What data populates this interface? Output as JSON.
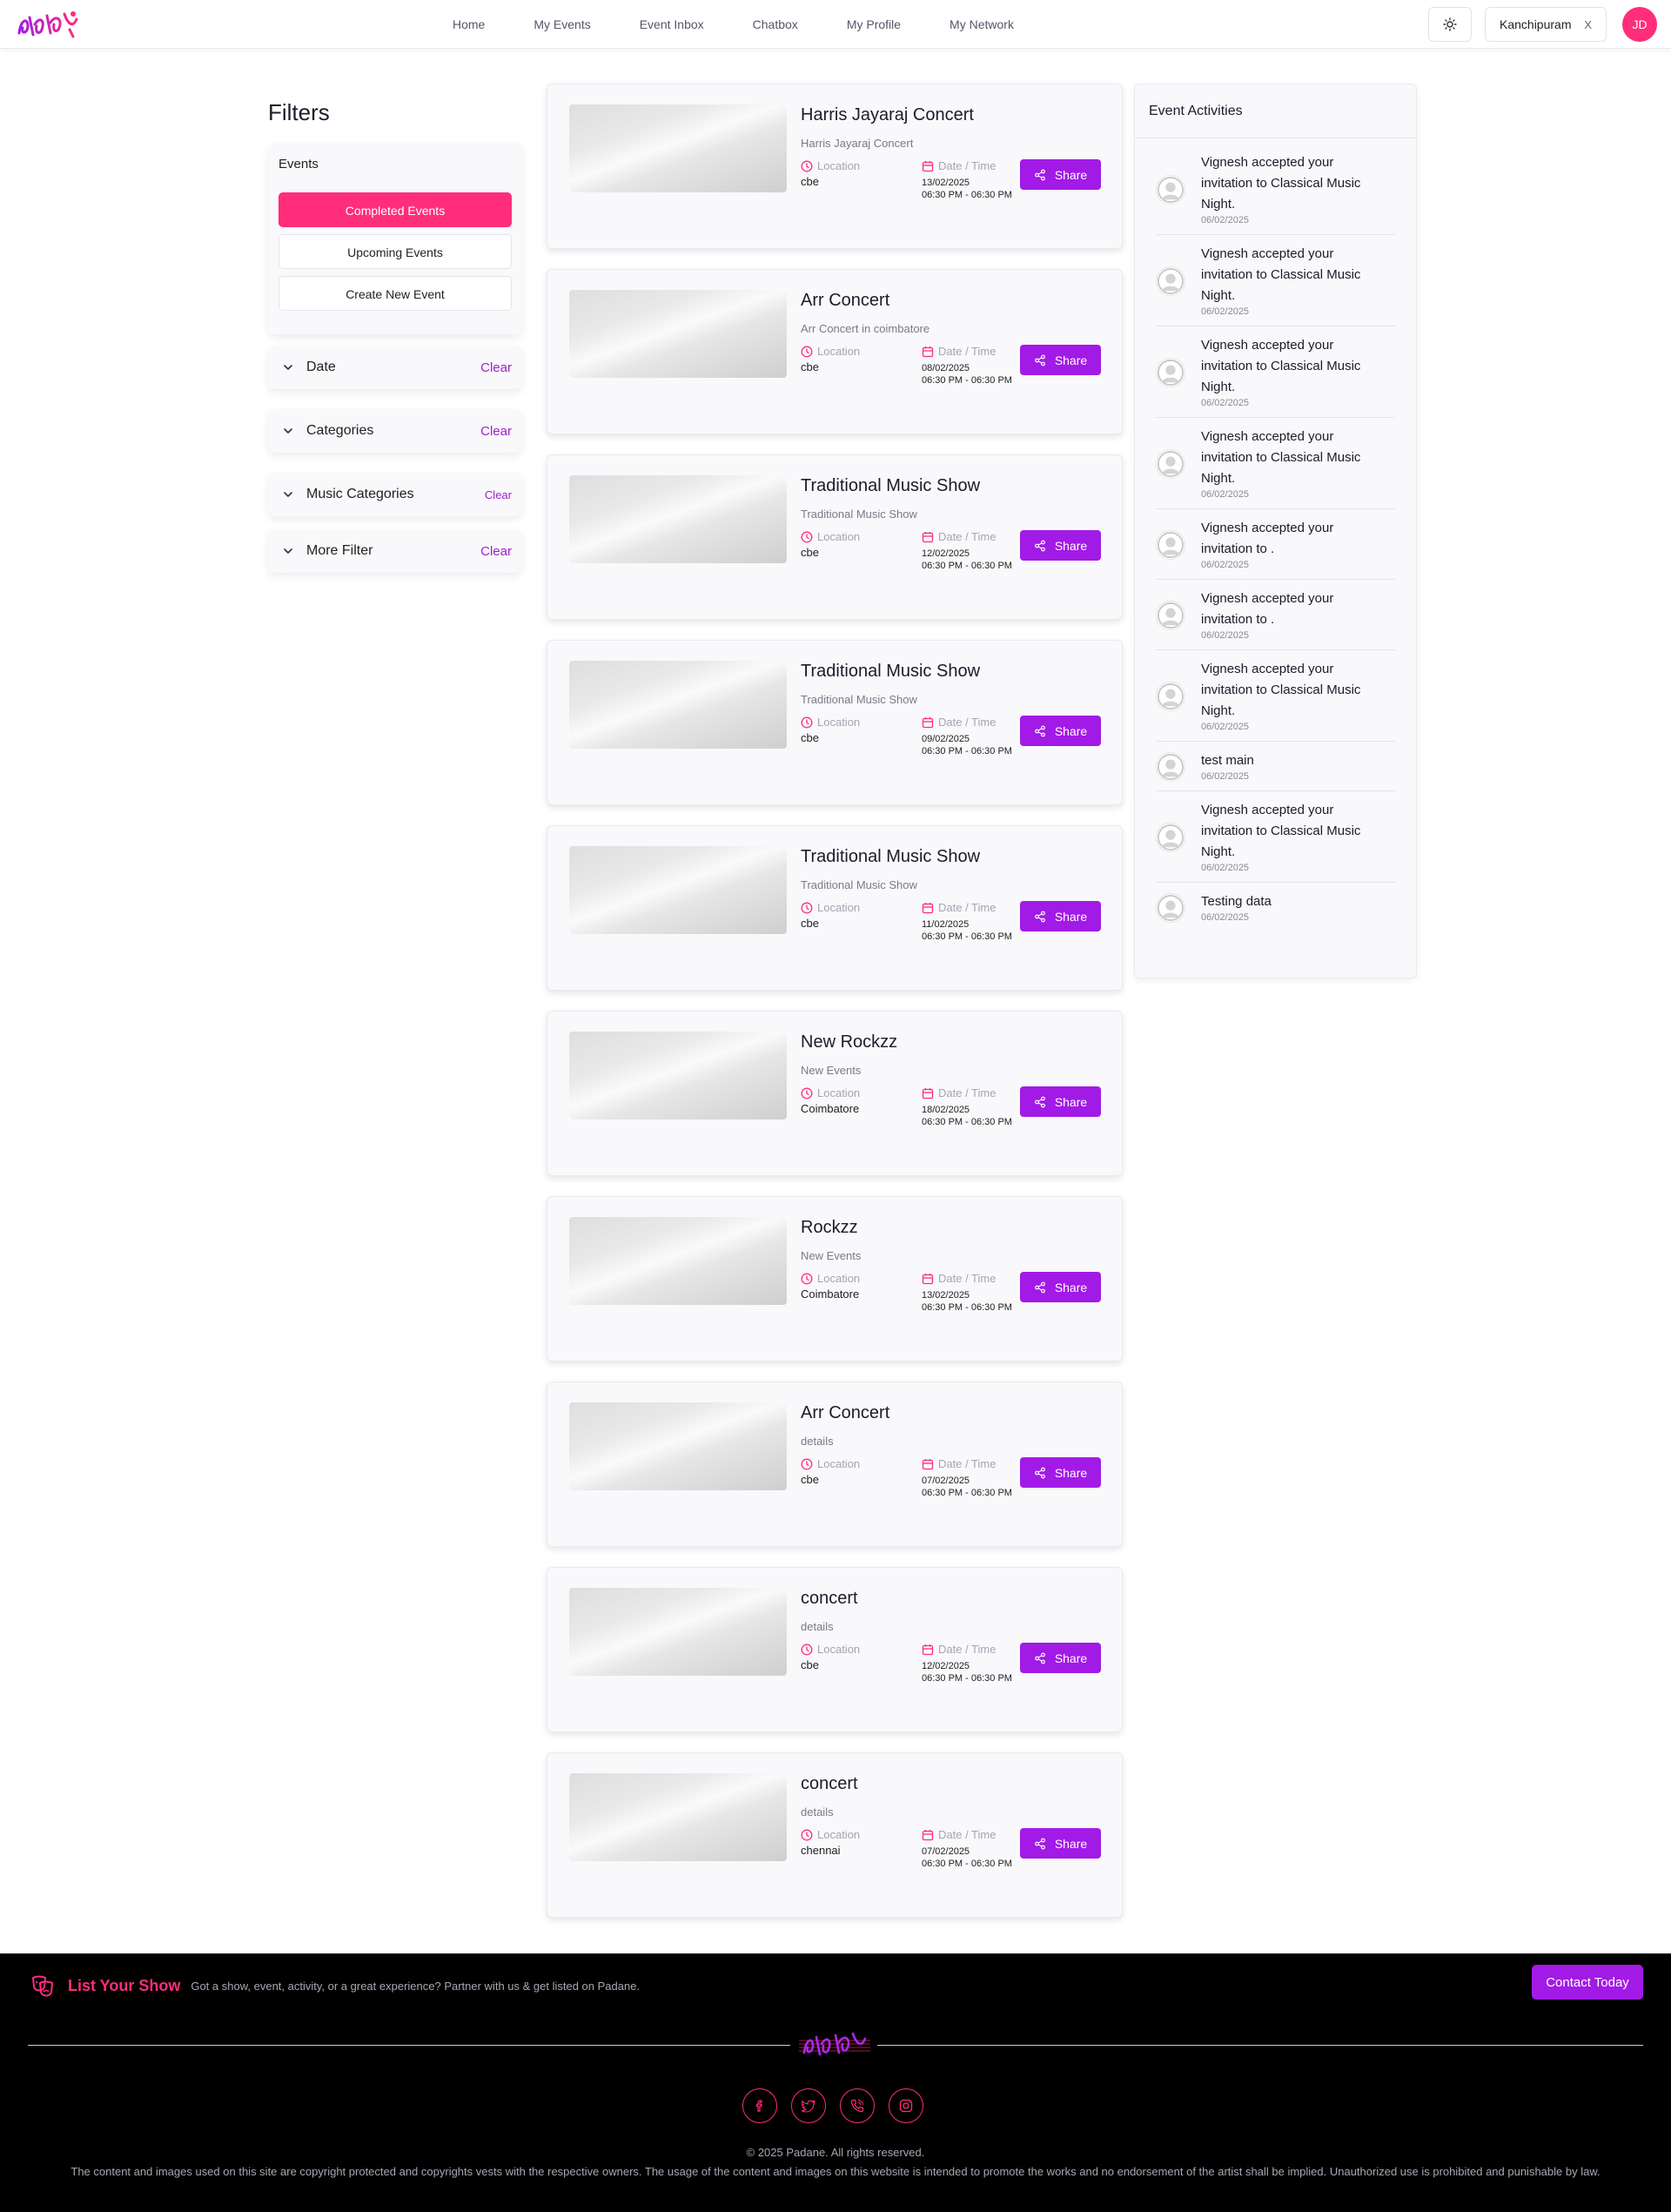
{
  "header": {
    "logo_alt": "Padane",
    "nav": [
      "Home",
      "My Events",
      "Event Inbox",
      "Chatbox",
      "My Profile",
      "My Network"
    ],
    "location": "Kanchipuram",
    "location_clear": "X",
    "avatar_initials": "JD"
  },
  "filters": {
    "title": "Filters",
    "events_title": "Events",
    "buttons": [
      "Completed Events",
      "Upcoming Events",
      "Create New Event"
    ],
    "active_button": "Completed Events",
    "sections": [
      {
        "label": "Date",
        "clear": "Clear"
      },
      {
        "label": "Categories",
        "clear": "Clear"
      },
      {
        "label": "Music Categories",
        "clear": "Clear"
      },
      {
        "label": "More Filter",
        "clear": "Clear"
      }
    ]
  },
  "labels": {
    "location": "Location",
    "datetime": "Date / Time",
    "share": "Share"
  },
  "events": [
    {
      "title": "Harris Jayaraj Concert",
      "subtitle": "Harris Jayaraj Concert",
      "location": "cbe",
      "date": "13/02/2025",
      "time": "06:30 PM - 06:30 PM"
    },
    {
      "title": "Arr Concert",
      "subtitle": "Arr Concert in coimbatore",
      "location": "cbe",
      "date": "08/02/2025",
      "time": "06:30 PM - 06:30 PM"
    },
    {
      "title": "Traditional Music Show",
      "subtitle": "Traditional Music Show",
      "location": "cbe",
      "date": "12/02/2025",
      "time": "06:30 PM - 06:30 PM"
    },
    {
      "title": "Traditional Music Show",
      "subtitle": "Traditional Music Show",
      "location": "cbe",
      "date": "09/02/2025",
      "time": "06:30 PM - 06:30 PM"
    },
    {
      "title": "Traditional Music Show",
      "subtitle": "Traditional Music Show",
      "location": "cbe",
      "date": "11/02/2025",
      "time": "06:30 PM - 06:30 PM"
    },
    {
      "title": "New Rockzz",
      "subtitle": "New Events",
      "location": "Coimbatore",
      "date": "18/02/2025",
      "time": "06:30 PM - 06:30 PM"
    },
    {
      "title": "Rockzz",
      "subtitle": "New Events",
      "location": "Coimbatore",
      "date": "13/02/2025",
      "time": "06:30 PM - 06:30 PM"
    },
    {
      "title": "Arr Concert",
      "subtitle": "details",
      "location": "cbe",
      "date": "07/02/2025",
      "time": "06:30 PM - 06:30 PM"
    },
    {
      "title": "concert",
      "subtitle": "details",
      "location": "cbe",
      "date": "12/02/2025",
      "time": "06:30 PM - 06:30 PM"
    },
    {
      "title": "concert",
      "subtitle": "details",
      "location": "chennai",
      "date": "07/02/2025",
      "time": "06:30 PM - 06:30 PM"
    }
  ],
  "activities": {
    "title": "Event Activities",
    "items": [
      {
        "lines": [
          "Vignesh accepted your",
          "invitation to Classical Music",
          "Night."
        ],
        "date": "06/02/2025"
      },
      {
        "lines": [
          "Vignesh accepted your",
          "invitation to Classical Music",
          "Night."
        ],
        "date": "06/02/2025"
      },
      {
        "lines": [
          "Vignesh accepted your",
          "invitation to Classical Music",
          "Night."
        ],
        "date": "06/02/2025"
      },
      {
        "lines": [
          "Vignesh accepted your",
          "invitation to Classical Music",
          "Night."
        ],
        "date": "06/02/2025"
      },
      {
        "lines": [
          "Vignesh accepted your",
          "invitation to ."
        ],
        "date": "06/02/2025"
      },
      {
        "lines": [
          "Vignesh accepted your",
          "invitation to ."
        ],
        "date": "06/02/2025"
      },
      {
        "lines": [
          "Vignesh accepted your",
          "invitation to Classical Music",
          "Night."
        ],
        "date": "06/02/2025"
      },
      {
        "lines": [
          "test main"
        ],
        "date": "06/02/2025"
      },
      {
        "lines": [
          "Vignesh accepted your",
          "invitation to Classical Music",
          "Night."
        ],
        "date": "06/02/2025"
      },
      {
        "lines": [
          "Testing data"
        ],
        "date": "06/02/2025"
      }
    ]
  },
  "footer": {
    "list_title": "List Your Show",
    "list_desc": "Got a show, event, activity, or a great experience? Partner with us & get listed on Padane.",
    "contact": "Contact Today",
    "socials": [
      "facebook-icon",
      "twitter-icon",
      "phone-icon",
      "instagram-icon"
    ],
    "copyright": "© 2025 Padane. All rights reserved.",
    "disclaimer": "The content and images used on this site are copyright protected and copyrights vests with the respective owners. The usage of the content and images on this website is intended to promote the works and no endorsement of the artist shall be implied. Unauthorized use is prohibited and punishable by law."
  },
  "colors": {
    "primary_pink": "#ff2d7a",
    "share_purple": "#a21ae6",
    "clear_purple": "#a11fcf",
    "footer_bg": "#000000"
  }
}
